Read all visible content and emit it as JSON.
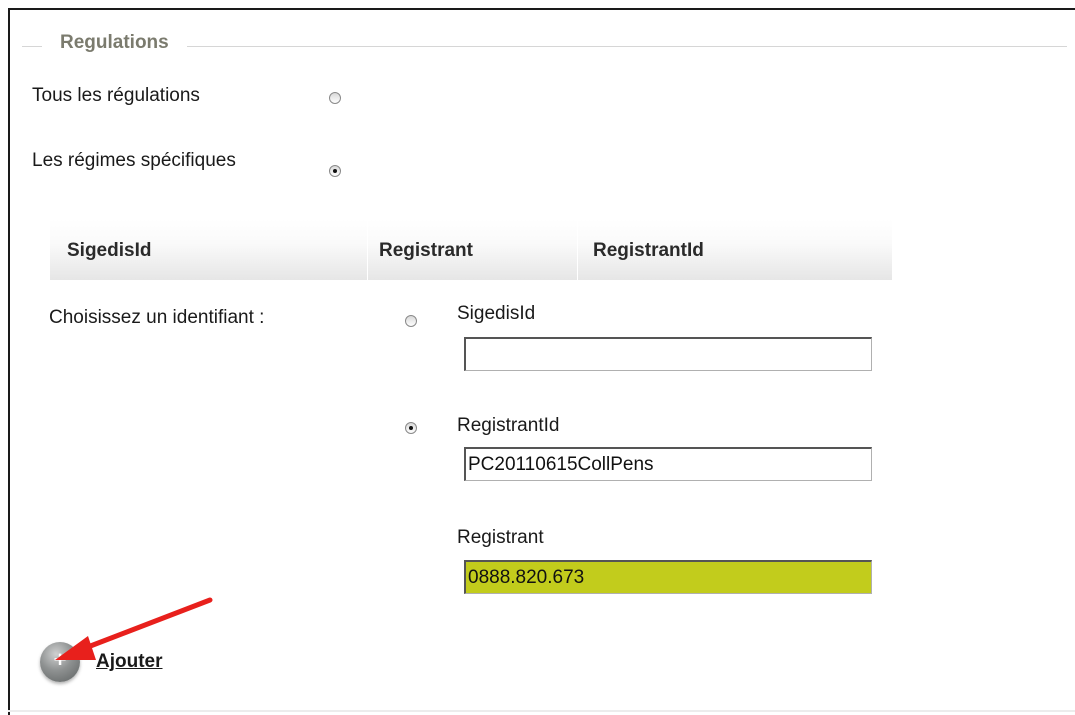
{
  "section": {
    "legend": "Regulations"
  },
  "scope": {
    "all_label": "Tous les régulations",
    "all_selected": false,
    "specific_label": "Les régimes spécifiques",
    "specific_selected": true
  },
  "table": {
    "columns": [
      "SigedisId",
      "Registrant",
      "RegistrantId"
    ]
  },
  "identifier": {
    "prompt": "Choisissez un identifiant :",
    "sigedis_label": "SigedisId",
    "sigedis_value": "",
    "sigedis_selected": false,
    "registrant_id_label": "RegistrantId",
    "registrant_id_value": "PC20110615CollPens",
    "registrant_id_selected": true,
    "registrant_label": "Registrant",
    "registrant_value": "0888.820.673"
  },
  "actions": {
    "add_label": "Ajouter"
  },
  "colors": {
    "highlight": "#c2cc1c",
    "annotation_arrow": "#e8201c"
  },
  "icons": {
    "add": "plus-circle-icon",
    "annotation": "red-arrow-icon"
  }
}
